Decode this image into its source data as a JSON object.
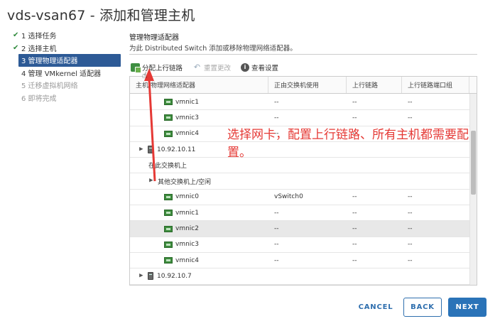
{
  "dialog": {
    "title": "vds-vsan67 - 添加和管理主机"
  },
  "steps": [
    {
      "label": "1 选择任务",
      "state": "done"
    },
    {
      "label": "2 选择主机",
      "state": "done"
    },
    {
      "label": "3 管理物理适配器",
      "state": "active"
    },
    {
      "label": "4 管理 VMkernel 适配器",
      "state": "todo"
    },
    {
      "label": "5 迁移虚拟机网络",
      "state": "disabled"
    },
    {
      "label": "6 即将完成",
      "state": "disabled"
    }
  ],
  "panel": {
    "title": "管理物理适配器",
    "description": "为此 Distributed Switch 添加或移除物理网络适配器。"
  },
  "toolbar": {
    "assign_uplink": "分配上行链路",
    "reset_changes": "重置更改",
    "view_settings": "查看设置"
  },
  "table": {
    "columns": [
      "主机/物理网络适配器",
      "正由交换机使用",
      "上行链路",
      "上行链路端口组"
    ],
    "rows": [
      {
        "kind": "nic",
        "name": "vmnic1",
        "switch": "--",
        "uplink": "--",
        "portgroup": "--",
        "indent": 2
      },
      {
        "kind": "nic",
        "name": "vmnic3",
        "switch": "--",
        "uplink": "--",
        "portgroup": "--",
        "indent": 2
      },
      {
        "kind": "nic",
        "name": "vmnic4",
        "switch": "--",
        "uplink": "--",
        "portgroup": "--",
        "indent": 2
      },
      {
        "kind": "host",
        "name": "10.92.10.11",
        "switch": "",
        "uplink": "",
        "portgroup": "",
        "indent": 0
      },
      {
        "kind": "group",
        "name": "在此交换机上",
        "switch": "",
        "uplink": "",
        "portgroup": "",
        "indent": 1,
        "expanded": false
      },
      {
        "kind": "group",
        "name": "其他交换机上/空闲",
        "switch": "",
        "uplink": "",
        "portgroup": "",
        "indent": 1,
        "expanded": true
      },
      {
        "kind": "nic",
        "name": "vmnic0",
        "switch": "vSwitch0",
        "uplink": "--",
        "portgroup": "--",
        "indent": 2
      },
      {
        "kind": "nic",
        "name": "vmnic1",
        "switch": "--",
        "uplink": "--",
        "portgroup": "--",
        "indent": 2
      },
      {
        "kind": "nic",
        "name": "vmnic2",
        "switch": "--",
        "uplink": "--",
        "portgroup": "--",
        "indent": 2,
        "selected": true
      },
      {
        "kind": "nic",
        "name": "vmnic3",
        "switch": "--",
        "uplink": "--",
        "portgroup": "--",
        "indent": 2
      },
      {
        "kind": "nic",
        "name": "vmnic4",
        "switch": "--",
        "uplink": "--",
        "portgroup": "--",
        "indent": 2
      },
      {
        "kind": "host",
        "name": "10.92.10.7",
        "switch": "",
        "uplink": "",
        "portgroup": "",
        "indent": 0
      }
    ]
  },
  "annotation": {
    "text": "选择网卡，配置上行链路、所有主机都需要配置。",
    "color": "#e53935"
  },
  "buttons": {
    "cancel": "CANCEL",
    "back": "BACK",
    "next": "NEXT"
  },
  "colors": {
    "accent": "#2a73b8",
    "active_step": "#2d5a96",
    "check": "#2f8a3c"
  }
}
